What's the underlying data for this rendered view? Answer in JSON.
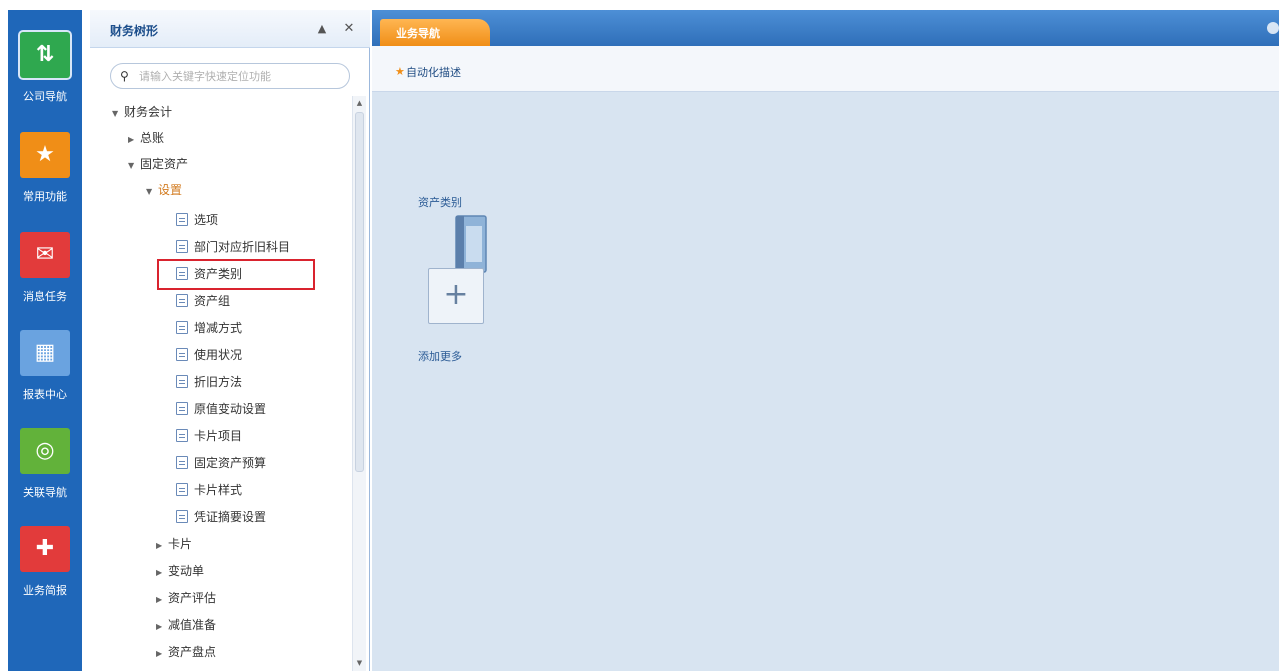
{
  "rail": {
    "items": [
      {
        "label": "公司导航",
        "color": "#2fa84f",
        "icon": "navigation-icon"
      },
      {
        "label": "常用功能",
        "color": "#f08e17",
        "icon": "star-icon"
      },
      {
        "label": "消息任务",
        "color": "#e23b3b",
        "icon": "message-icon"
      },
      {
        "label": "报表中心",
        "color": "#4d8fd6",
        "icon": "report-icon"
      },
      {
        "label": "关联导航",
        "color": "#62b23a",
        "icon": "compass-icon"
      },
      {
        "label": "业务简报",
        "color": "#e23b3b",
        "icon": "briefing-icon"
      }
    ]
  },
  "tree": {
    "title": "财务树形",
    "search_placeholder": "请输入关键字快速定位功能",
    "nodes": [
      {
        "label": "财务会计",
        "level": 0,
        "arrow": "▼"
      },
      {
        "label": "总账",
        "level": 1,
        "arrow": "▶"
      },
      {
        "label": "固定资产",
        "level": 1,
        "arrow": "▼"
      },
      {
        "label": "设置",
        "level": 2,
        "arrow": "▼",
        "orange": true
      },
      {
        "label": "选项",
        "level": 3,
        "doc": true
      },
      {
        "label": "部门对应折旧科目",
        "level": 3,
        "doc": true
      },
      {
        "label": "资产类别",
        "level": 3,
        "doc": true
      },
      {
        "label": "资产组",
        "level": 3,
        "doc": true
      },
      {
        "label": "增减方式",
        "level": 3,
        "doc": true
      },
      {
        "label": "使用状况",
        "level": 3,
        "doc": true
      },
      {
        "label": "折旧方法",
        "level": 3,
        "doc": true
      },
      {
        "label": "原值变动设置",
        "level": 3,
        "doc": true
      },
      {
        "label": "卡片项目",
        "level": 3,
        "doc": true
      },
      {
        "label": "固定资产预算",
        "level": 3,
        "doc": true
      },
      {
        "label": "卡片样式",
        "level": 3,
        "doc": true
      },
      {
        "label": "凭证摘要设置",
        "level": 3,
        "doc": true
      },
      {
        "label": "卡片",
        "level": 2,
        "arrow": "▶"
      },
      {
        "label": "变动单",
        "level": 2,
        "arrow": "▶"
      },
      {
        "label": "资产评估",
        "level": 2,
        "arrow": "▶"
      },
      {
        "label": "减值准备",
        "level": 2,
        "arrow": "▶"
      },
      {
        "label": "资产盘点",
        "level": 2,
        "arrow": "▶"
      }
    ]
  },
  "main": {
    "tab_label": "业务导航",
    "toolbar_label": "自动化描述",
    "shortcuts": [
      {
        "label": "资产类别"
      },
      {
        "label": "添加更多"
      }
    ]
  }
}
